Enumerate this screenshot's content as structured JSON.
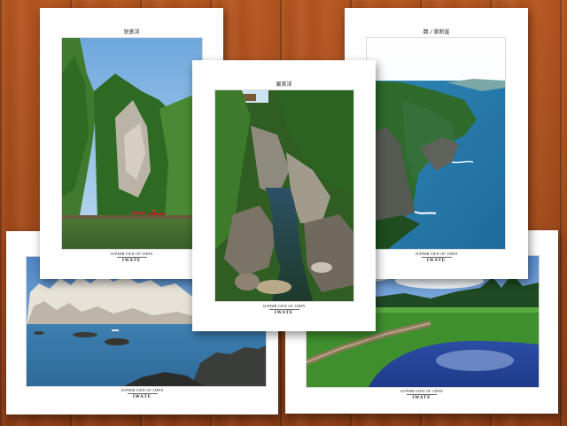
{
  "scene": {
    "description_colors": {
      "wood": "#a84d1b",
      "card": "#ffffff"
    }
  },
  "cards": [
    {
      "id": "bottom-left",
      "title": "",
      "caption_sub": "SUPERB VIEW OF JAPAN",
      "caption_main": "IWATE"
    },
    {
      "id": "bottom-right",
      "title": "",
      "caption_sub": "SUPERB VIEW OF JAPAN",
      "caption_main": "IWATE"
    },
    {
      "id": "top-left",
      "title": "猊鼻渓",
      "caption_sub": "SUPERB VIEW OF JAPAN",
      "caption_main": "IWATE"
    },
    {
      "id": "top-right",
      "title": "鵜ノ巣断崖",
      "caption_sub": "SUPERB VIEW OF JAPAN",
      "caption_main": "IWATE"
    },
    {
      "id": "center",
      "title": "厳美渓",
      "caption_sub": "SUPERB VIEW OF JAPAN",
      "caption_main": "IWATE"
    }
  ]
}
